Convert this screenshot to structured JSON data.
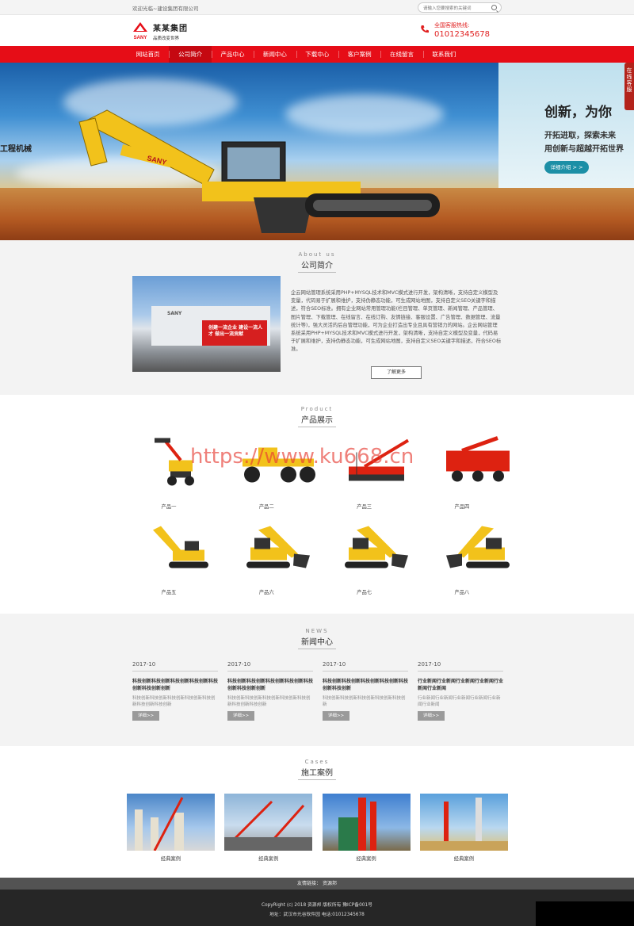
{
  "topbar": {
    "welcome": "欢迎光临~建设集团有限公司",
    "search_placeholder": "请输入您要搜索的关键词"
  },
  "header": {
    "brand_name": "某某集团",
    "slogan": "品质改变世界",
    "logo_text": "SANY",
    "hotline_label": "全国客服热线:",
    "hotline_number": "01012345678"
  },
  "nav": {
    "items": [
      "网站首页",
      "公司简介",
      "产品中心",
      "新闻中心",
      "下载中心",
      "客户案例",
      "在线留言",
      "联系我们"
    ]
  },
  "banner": {
    "left_text": "工程机械",
    "headline": "创新，为你",
    "line1": "开拓进取，探索未来",
    "line2": "用创新与超越开拓世界",
    "button": "详细介绍 > >",
    "machine_logo": "SANY",
    "side_tab": "在线客服"
  },
  "about": {
    "en": "About us",
    "cn": "公司简介",
    "text": "企云网站管理系统采用PHP+MYSQL技术和MVC模式进行开发，架构清晰，支持自定义模型及变量，代码易于扩展和维护，支持伪静态功能，可生成网站地图，支持自定义SEO关键字和描述，符合SEO标准。拥有企业网站常用管理功能(栏目管理、单页管理、新闻管理、产品管理、图片管理、下载管理、在线留言、在线订购、友情链接、客服设置、广告管理、数据管理、流量统计等)，强大灵活的后台管理功能，可为企业打造出专业且具有营销力的网站。企云网站管理系统采用PHP+MYSQL技术和MVC模式进行开发，架构清晰，支持自定义模型及变量，代码易于扩展和维护，支持伪静态功能，可生成网站地图，支持自定义SEO关键字和描述，符合SEO标准。",
    "more": "了解更多",
    "image_sign": "创建一流企业 建设一流人才 做出一流贡献",
    "image_logo": "SANY"
  },
  "products": {
    "en": "Product",
    "cn": "产品展示",
    "items": [
      "产品一",
      "产品二",
      "产品三",
      "产品四",
      "产品五",
      "产品六",
      "产品七",
      "产品八"
    ]
  },
  "watermark": "https://www.ku668.cn",
  "news": {
    "en": "NEWS",
    "cn": "新闻中心",
    "items": [
      {
        "date": "2017-10",
        "title": "科技创新科技创新科技创新科技创新科技创新科技创新创新",
        "desc": "科技创新科技创新科技创新科技创新科技创新科技创新科技创新",
        "more": "详细>>"
      },
      {
        "date": "2017-10",
        "title": "科技创新科技创新科技创新科技创新科技创新科技创新创新",
        "desc": "科技创新科技创新科技创新科技创新科技创新科技创新科技创新",
        "more": "详细>>"
      },
      {
        "date": "2017-10",
        "title": "科技创新科技创新科技创新科技创新科技创新科技创新",
        "desc": "科技创新科技创新科技创新科技创新科技创新",
        "more": "详细>>"
      },
      {
        "date": "2017-10",
        "title": "行业新闻行业新闻行业新闻行业新闻行业新闻行业新闻",
        "desc": "行业新闻行业新闻行业新闻行业新闻行业新闻行业新闻",
        "more": "详细>>"
      }
    ]
  },
  "cases": {
    "en": "Cases",
    "cn": "施工案例",
    "items": [
      "经典案例",
      "经典案例",
      "经典案例",
      "经典案例"
    ]
  },
  "links": {
    "label": "友情链接：",
    "item": "资源邦"
  },
  "footer": {
    "copyright": "CopyRight (c) 2018 资源邦 版权所有  豫ICP备001号",
    "address": "地址：武汉市光谷软件园  电话:01012345678"
  },
  "colors": {
    "brand_red": "#e60d17",
    "accent_teal": "#1c8fa6",
    "footer_dark": "#262626"
  }
}
